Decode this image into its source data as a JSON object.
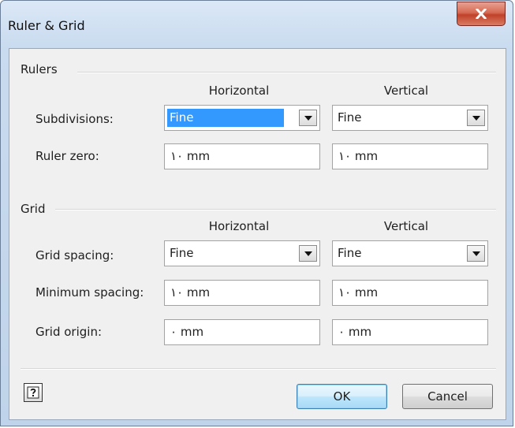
{
  "window": {
    "title": "Ruler & Grid"
  },
  "rulers": {
    "section_label": "Rulers",
    "col_horizontal": "Horizontal",
    "col_vertical": "Vertical",
    "subdivisions": {
      "label": "Subdivisions:",
      "horizontal": "Fine",
      "vertical": "Fine"
    },
    "ruler_zero": {
      "label": "Ruler zero:",
      "horizontal": "١٠ mm",
      "vertical": "١٠ mm"
    }
  },
  "grid": {
    "section_label": "Grid",
    "col_horizontal": "Horizontal",
    "col_vertical": "Vertical",
    "grid_spacing": {
      "label": "Grid spacing:",
      "horizontal": "Fine",
      "vertical": "Fine"
    },
    "minimum_spacing": {
      "label": "Minimum spacing:",
      "horizontal": "١٠ mm",
      "vertical": "١٠ mm"
    },
    "grid_origin": {
      "label": "Grid origin:",
      "horizontal": "٠ mm",
      "vertical": "٠ mm"
    }
  },
  "footer": {
    "help_icon": "help-question-icon",
    "ok_label": "OK",
    "cancel_label": "Cancel"
  },
  "colors": {
    "selection": "#3399ff",
    "close_button": "#c0412a",
    "default_button_border": "#3c7fb1"
  }
}
